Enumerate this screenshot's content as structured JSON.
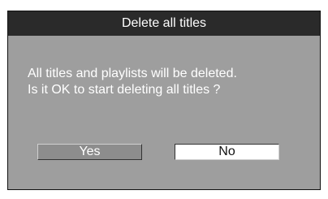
{
  "dialog": {
    "title": "Delete all titles",
    "message_line1": "All titles and playlists will be deleted.",
    "message_line2": "Is it OK to start deleting all titles ?",
    "buttons": {
      "yes": "Yes",
      "no": "No"
    }
  },
  "colors": {
    "title_bar_bg": "#2a2a2a",
    "dialog_bg": "#9e9e9e",
    "text_light": "#ffffff",
    "yes_button_bg": "#8d8d8d",
    "no_button_bg": "#ffffff"
  }
}
